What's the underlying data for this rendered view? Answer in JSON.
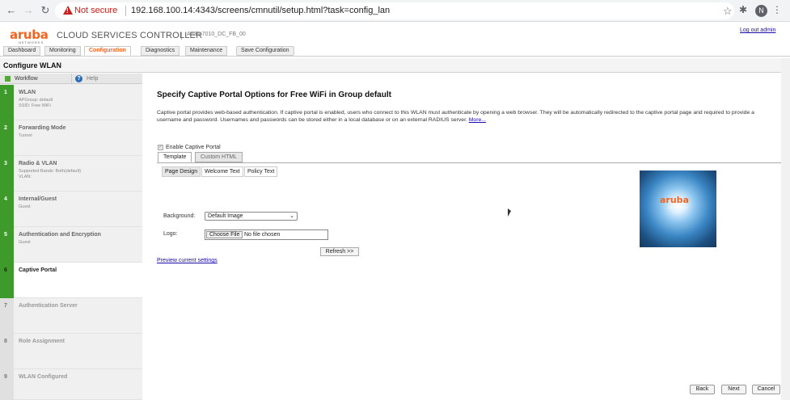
{
  "browser": {
    "not_secure": "Not secure",
    "url": "192.168.100.14:4343/screens/cmnutil/setup.html?task=config_lan",
    "avatar_initial": "N"
  },
  "header": {
    "logo_word": "aruba",
    "logo_sub": "NETWORKS",
    "title": "CLOUD SERVICES CONTROLLER",
    "separator": "|",
    "hostname": "Aruba7010_DC_FB_00",
    "logout": "Log out admin",
    "tabs": [
      {
        "label": "Dashboard",
        "active": false
      },
      {
        "label": "Monitoring",
        "active": false
      },
      {
        "label": "Configuration",
        "active": true
      },
      {
        "label": "Diagnostics",
        "active": false
      },
      {
        "label": "Maintenance",
        "active": false
      },
      {
        "label": "Save Configuration",
        "active": false
      }
    ]
  },
  "section_title": "Configure WLAN",
  "sidebar": {
    "workflow_label": "Workflow",
    "help_label": "Help",
    "steps": [
      {
        "num": "1",
        "title": "WLAN",
        "sub1": "APGroup: default",
        "sub2": "SSID: Free WiFi",
        "state": "done"
      },
      {
        "num": "2",
        "title": "Forwarding Mode",
        "sub1": "Tunnel",
        "sub2": "",
        "state": "done"
      },
      {
        "num": "3",
        "title": "Radio & VLAN",
        "sub1": "Supported Bands: Both(default)",
        "sub2": "VLAN:",
        "state": "done"
      },
      {
        "num": "4",
        "title": "Internal/Guest",
        "sub1": "Guest",
        "sub2": "",
        "state": "done"
      },
      {
        "num": "5",
        "title": "Authentication and Encryption",
        "sub1": "Guest",
        "sub2": "",
        "state": "done"
      },
      {
        "num": "6",
        "title": "Captive Portal",
        "sub1": "",
        "sub2": "",
        "state": "current"
      },
      {
        "num": "7",
        "title": "Authentication Server",
        "sub1": "",
        "sub2": "",
        "state": "todo"
      },
      {
        "num": "8",
        "title": "Role Assignment",
        "sub1": "",
        "sub2": "",
        "state": "todo"
      },
      {
        "num": "9",
        "title": "WLAN Configured",
        "sub1": "",
        "sub2": "",
        "state": "todo"
      }
    ]
  },
  "main": {
    "title": "Specify Captive Portal Options for Free WiFi in Group default",
    "description": "Captive portal provides web-based authentication. If captive portal is enabled, users who connect to this WLAN must authenticate by opening a web browser. They will be automatically redirected to the captive portal page and required to provide a username and password. Usernames and passwords can be stored either in a local database or on an external RADIUS server. ",
    "more_link": "More...",
    "enable_label": "Enable Captive Portal",
    "enable_checked": true,
    "tabs": [
      "Template",
      "Custom HTML"
    ],
    "inner_tabs": [
      "Page Design",
      "Welcome Text",
      "Policy Text"
    ],
    "background_label": "Background:",
    "background_value": "Default Image",
    "logo_label": "Logo:",
    "choose_file": "Choose File",
    "no_file": "No file chosen",
    "refresh": "Refresh >>",
    "preview_link": "Preview current settings",
    "preview_logo": "aruba",
    "preview_logo_sub": "NETWORKS"
  },
  "footer": {
    "back": "Back",
    "next": "Next",
    "cancel": "Cancel"
  },
  "colors": {
    "accent": "#f26522",
    "step_done": "#3d9a2b",
    "link": "#1a0dab",
    "not_secure": "#c5221f"
  }
}
